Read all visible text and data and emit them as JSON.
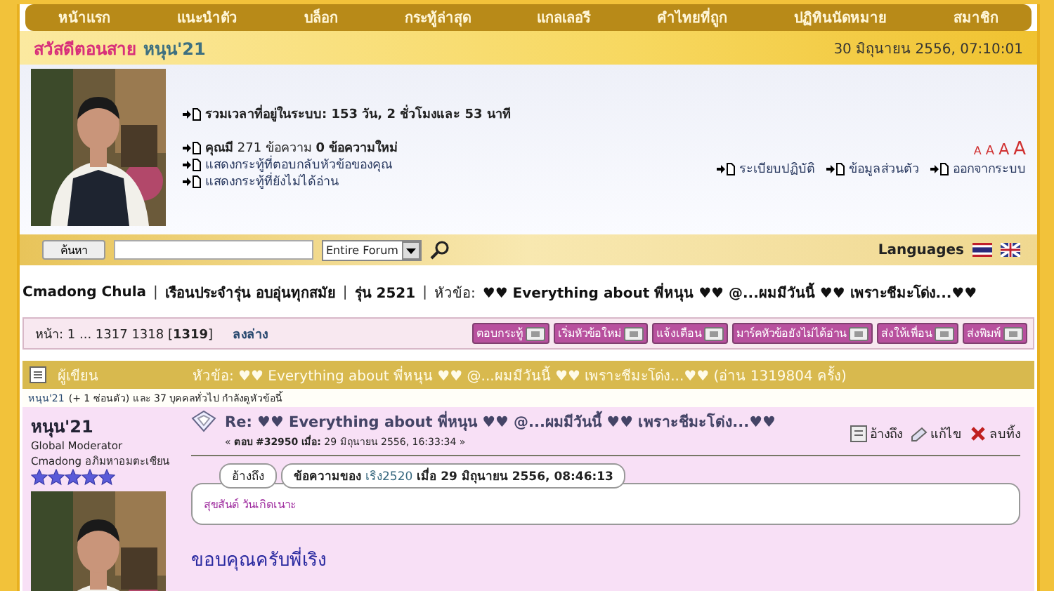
{
  "nav": [
    {
      "label": "หน้าแรก"
    },
    {
      "label": "แนะนำตัว"
    },
    {
      "label": "บล็อก"
    },
    {
      "label": "กระทู้ล่าสุด"
    },
    {
      "label": "แกลเลอรี"
    },
    {
      "label": "คำไทยที่ถูก"
    },
    {
      "label": "ปฏิทินนัดหมาย"
    },
    {
      "label": "สมาชิก"
    }
  ],
  "welcome": {
    "greeting": "สวัสดีตอนสาย",
    "username": "หนุน'21",
    "datetime": "30 มิถุนายน 2556, 07:10:01"
  },
  "user_panel": {
    "online_time": "รวมเวลาที่อยู่ในระบบ: 153 วัน, 2 ชั่วโมงและ 53 นาที",
    "messages": "**คุณมี** 271 ข้อความ **0 ข้อความใหม่**",
    "links": [
      "แสดงกระทู้ที่ตอบกลับหัวข้อของคุณ",
      "แสดงกระทู้ที่ยังไม่ได้อ่าน"
    ],
    "font_sizes": [
      "A",
      "A",
      "A",
      "A"
    ],
    "account_links": [
      "ระเบียบปฏิบัติ",
      "ข้อมูลส่วนตัว",
      "ออกจากระบบ"
    ]
  },
  "search": {
    "button": "ค้นหา",
    "scope": "Entire Forum",
    "languages": "Languages"
  },
  "breadcrumb": {
    "separator": "|",
    "items": [
      "Cmadong Chula",
      "เรือนประจำรุ่น อบอุ่นทุกสมัย",
      "รุ่น 2521"
    ],
    "topic_label": "หัวข้อ:",
    "topic": "♥♥ Everything about พี่หนุน ♥♥ @...ผมมีวันนี้ ♥♥ เพราะชีมะโด่ง...♥♥"
  },
  "pages": {
    "text": "หน้า: 1 ... 1317 1318 [**1319**]",
    "jump": "ลงล่าง",
    "buttons": [
      "ตอบกระทู้",
      "เริ่มหัวข้อใหม่",
      "แจ้งเตือน",
      "มาร์คหัวข้อยังไม่ได้อ่าน",
      "ส่งให้เพื่อน",
      "ส่งพิมพ์"
    ]
  },
  "topic_header": {
    "author_column": "ผู้เขียน",
    "title": "หัวข้อ: ♥♥ Everything about พี่หนุน ♥♥ @...ผมมีวันนี้ ♥♥ เพราะชีมะโด่ง...♥♥  (อ่าน 1319804 ครั้ง)"
  },
  "viewers": {
    "user": "หนุน'21",
    "rest": "(+ 1 ซ่อนตัว) และ 37 บุคคลทั่วไป กำลังดูหัวข้อนี้"
  },
  "post": {
    "author": "หนุน'21",
    "role": "Global Moderator",
    "rank": "Cmadong อภิมหาอมตะเซียน",
    "stars": 5,
    "title": "Re: ♥♥ Everything about พี่หนุน ♥♥ @...ผมมีวันนี้ ♥♥ เพราะชีมะโด่ง...♥♥",
    "meta": "« **ตอบ #32950 เมื่อ:** 29 มิถุนายน 2556, 16:33:34 »",
    "actions": [
      "อ้างถึง",
      "แก้ไข",
      "ลบทิ้ง"
    ],
    "quote": {
      "tab": "อ้างถึง",
      "prefix": "ข้อความของ",
      "author": "เริง2520",
      "date": "เมื่อ 29 มิถุนายน 2556, 08:46:13",
      "body": "สุขสันต์ วันเกิดเนาะ"
    },
    "message": "ขอบคุณครับพี่เริง"
  }
}
